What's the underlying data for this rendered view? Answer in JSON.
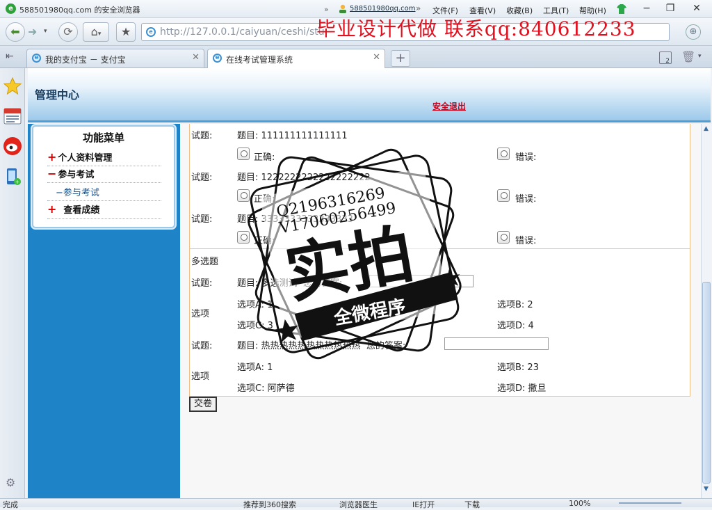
{
  "browser": {
    "title_user": "588501980qq.com",
    "title_suffix": "的安全浏览器",
    "account": "588501980qq.com",
    "menus": [
      "文件(F)",
      "查看(V)",
      "收藏(B)",
      "工具(T)",
      "帮助(H)"
    ],
    "url": "http://127.0.0.1/caiyuan/ceshi/stu",
    "watermark": "毕业设计代做 联系qq:840612233",
    "tabs": [
      {
        "label": "我的支付宝 － 支付宝",
        "active": false
      },
      {
        "label": "在线考试管理系统",
        "active": true
      }
    ],
    "tab_count": "2",
    "status_left": "完成",
    "status_items": [
      "推荐到360搜索",
      "浏览器医生",
      "IE打开",
      "下载",
      "100%"
    ]
  },
  "header": {
    "title": "管理中心",
    "logout": "安全退出"
  },
  "menu": {
    "title": "功能菜单",
    "items": [
      {
        "sign": "+",
        "label": "个人资料管理"
      },
      {
        "sign": "−",
        "label": "参与考试"
      },
      {
        "sign": "−",
        "label": "参与考试",
        "sub": true
      },
      {
        "sign": "+",
        "label": "查看成绩"
      }
    ]
  },
  "exam": {
    "tf_questions": [
      {
        "label": "试题:",
        "prefix": "题目:",
        "text": "111111111111111",
        "opt_true": "正确:",
        "opt_false": "错误:"
      },
      {
        "label": "试题:",
        "prefix": "题目:",
        "text": "1222222222222222222",
        "opt_true": "正确:",
        "opt_false": "错误:"
      },
      {
        "label": "试题:",
        "prefix": "题目:",
        "text": "3333333333333333",
        "opt_true": "正确:",
        "opt_false": "错误:"
      }
    ],
    "mc_title": "多选题",
    "mc_questions": [
      {
        "label": "试题:",
        "prefix": "题目:",
        "text": "多选测试",
        "answer_label": "您的答案:",
        "options_label": "选项",
        "A": "选项A:  1",
        "B": "选项B:  2",
        "C": "选项C:  3",
        "D": "选项D:  4"
      },
      {
        "label": "试题:",
        "prefix": "题目:",
        "text": "热热热热热热热热热热热",
        "answer_label": "您的答案:",
        "options_label": "选项",
        "A": "选项A:  1",
        "B": "选项B:  23",
        "C": "选项C:  阿萨德",
        "D": "选项D:  撒旦"
      }
    ],
    "submit_label": "交卷"
  },
  "stamp": {
    "contact1": "Q2196316269",
    "contact2": "V17060256499",
    "main": "实拍",
    "banner": "全微程序"
  }
}
